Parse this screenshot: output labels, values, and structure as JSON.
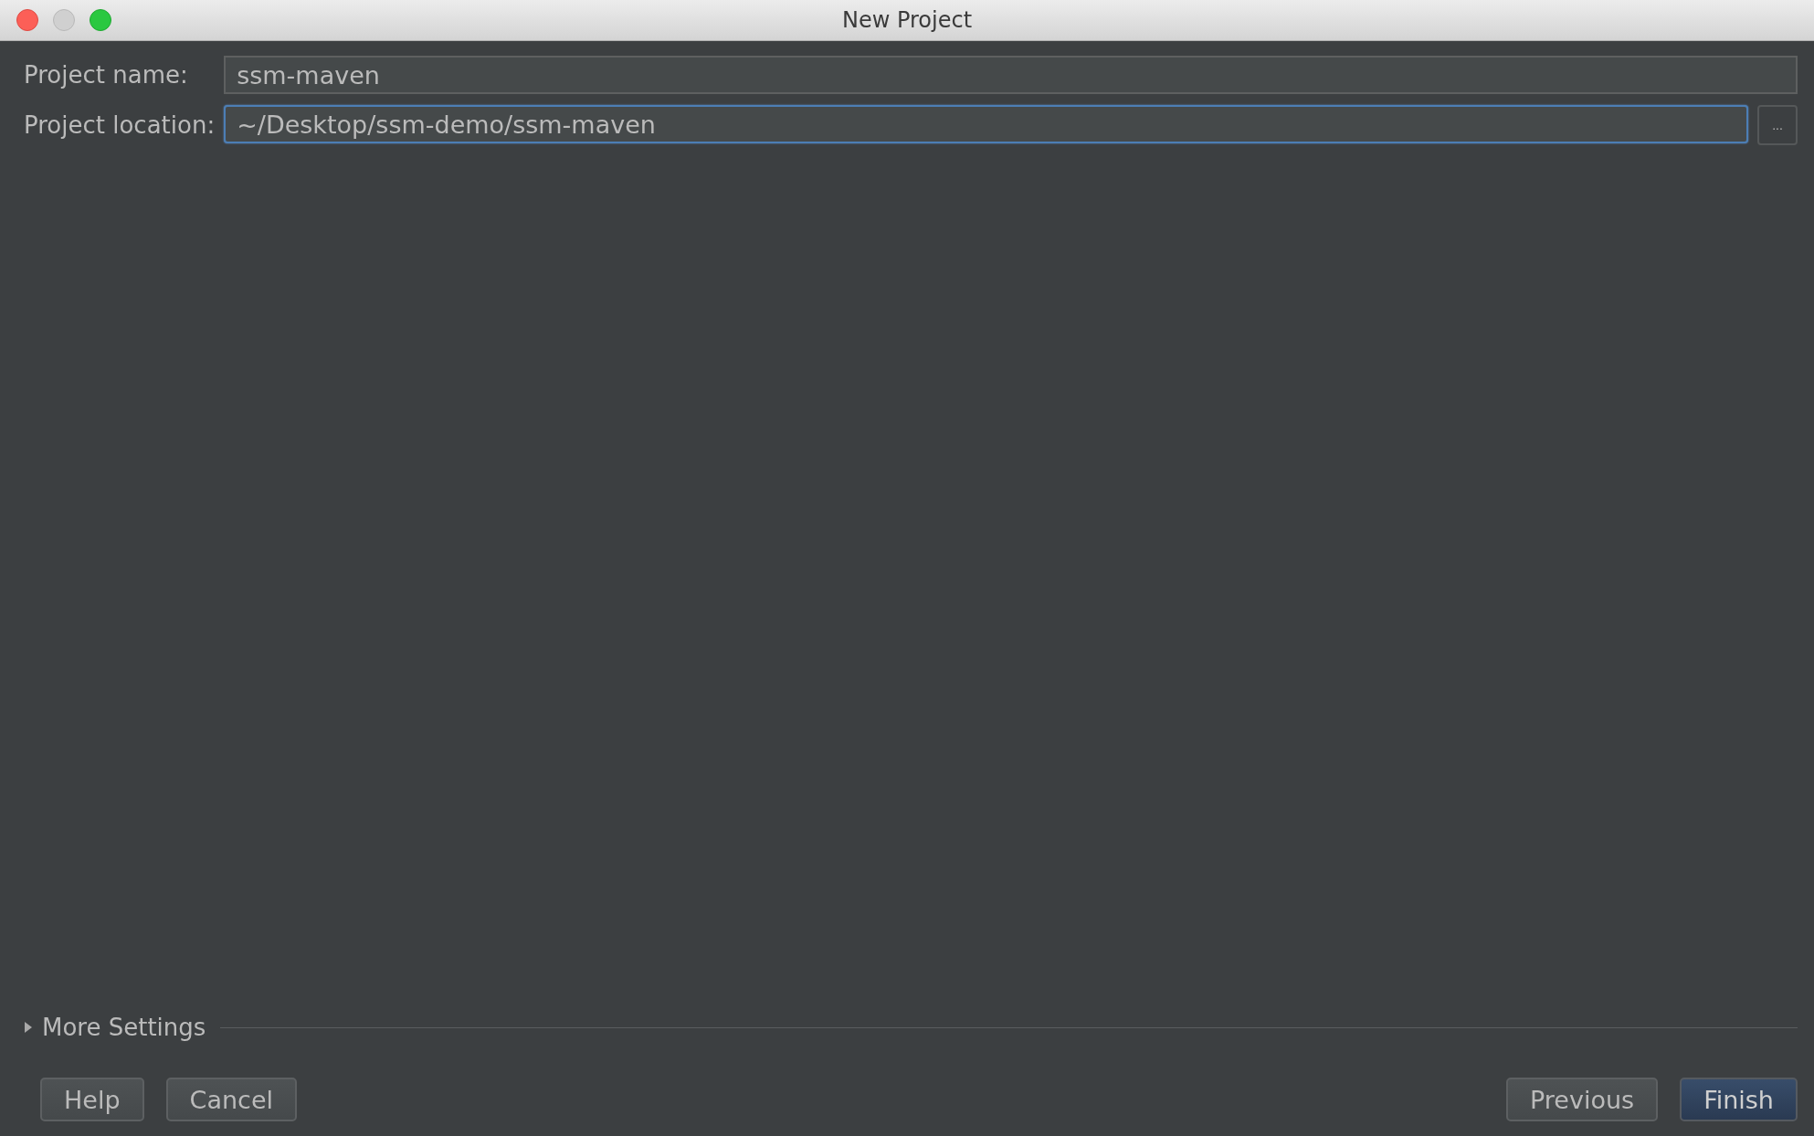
{
  "window": {
    "title": "New Project"
  },
  "fields": [
    {
      "label": "Project name:",
      "value": "ssm-maven",
      "focused": false
    },
    {
      "label": "Project location:",
      "value": "~/Desktop/ssm-demo/ssm-maven",
      "focused": true,
      "browse": "..."
    }
  ],
  "more_settings": {
    "label": "More Settings",
    "expanded": false
  },
  "buttons_left": [
    {
      "label": "Help",
      "primary": false
    },
    {
      "label": "Cancel",
      "primary": false
    }
  ],
  "buttons_right": [
    {
      "label": "Previous",
      "primary": false
    },
    {
      "label": "Finish",
      "primary": true
    }
  ]
}
